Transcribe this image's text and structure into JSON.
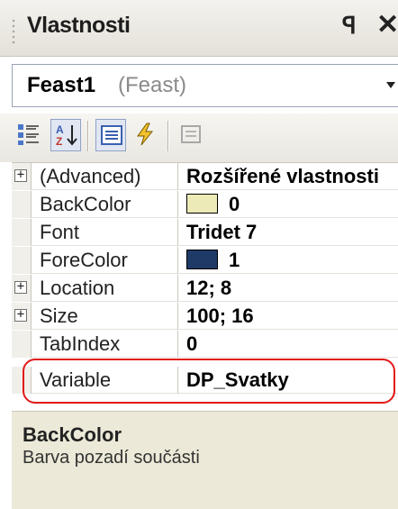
{
  "panel": {
    "title": "Vlastnosti",
    "pin_icon": "ꟼ",
    "close_icon": "✕"
  },
  "selector": {
    "object_name": "Feast1",
    "object_type": "(Feast)"
  },
  "toolbar": {
    "buttons": [
      {
        "icon": "categorized-icon",
        "pressed": false
      },
      {
        "icon": "alphabetical-sort-icon",
        "pressed": true
      },
      {
        "icon": "properties-icon",
        "pressed": true
      },
      {
        "icon": "events-lightning-icon",
        "pressed": false
      },
      {
        "icon": "property-pages-icon",
        "pressed": false
      }
    ]
  },
  "properties": [
    {
      "name": "(Advanced)",
      "value": "Rozšířené vlastnosti",
      "expandable": true
    },
    {
      "name": "BackColor",
      "value": "0",
      "swatch": "#eceab7",
      "expandable": false
    },
    {
      "name": "Font",
      "value": "Tridet 7",
      "expandable": false
    },
    {
      "name": "ForeColor",
      "value": "1",
      "swatch": "#1f3a66",
      "expandable": false
    },
    {
      "name": "Location",
      "value": "12; 8",
      "expandable": true
    },
    {
      "name": "Size",
      "value": "100; 16",
      "expandable": true
    },
    {
      "name": "TabIndex",
      "value": "0",
      "expandable": false
    },
    {
      "name": "Variable",
      "value": "DP_Svatky",
      "expandable": false
    }
  ],
  "description": {
    "title": "BackColor",
    "text": "Barva pozadí součásti"
  },
  "colors": {
    "highlight_ring": "#e11a1a",
    "panel_bg": "#ece9d8"
  }
}
